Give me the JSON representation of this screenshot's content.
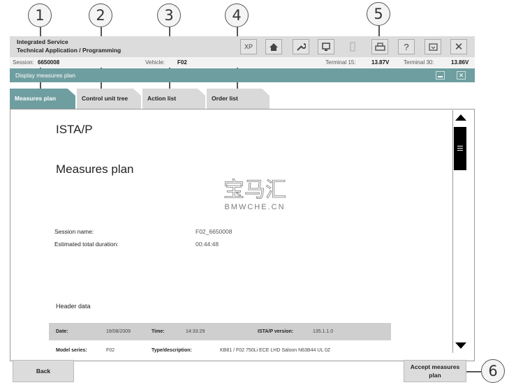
{
  "callouts": [
    "1",
    "2",
    "3",
    "4",
    "5",
    "6"
  ],
  "header": {
    "title_line1": "Integrated Service",
    "title_line2": "Technical Application / Programming",
    "xp_label": "XP",
    "help_glyph": "?",
    "close_glyph": "✕"
  },
  "session_bar": {
    "session_label": "Session:",
    "session_value": "6650008",
    "vehicle_label": "Vehicle:",
    "vehicle_value": "F02",
    "terminal15_label": "Terminal 15:",
    "terminal15_value": "13.87V",
    "terminal30_label": "Terminal 30:",
    "terminal30_value": "13.86V"
  },
  "window": {
    "title": "Display measures plan",
    "close_glyph": "✕"
  },
  "tabs": [
    {
      "label": "Measures plan",
      "active": true
    },
    {
      "label": "Control unit tree",
      "active": false
    },
    {
      "label": "Action list",
      "active": false
    },
    {
      "label": "Order list",
      "active": false
    }
  ],
  "document": {
    "app_name": "ISTA/P",
    "heading": "Measures plan",
    "session_name_label": "Session name:",
    "session_name_value": "F02_6650008",
    "duration_label": "Estimated total duration:",
    "duration_value": "00:44:48",
    "header_data_title": "Header data",
    "date_label": "Date:",
    "date_value": "19/08/2009",
    "time_label": "Time:",
    "time_value": "14:33:29",
    "version_label": "ISTA/P version:",
    "version_value": "135.1.1.0",
    "model_label": "Model series:",
    "model_value": "F02",
    "type_label": "Type/description:",
    "type_value": "KB81 / F02 750Li ECE LHD Saloon N63B44 UL 0Z"
  },
  "watermark": {
    "line1": "宝马汇",
    "line2": "BMWCHE.CN"
  },
  "buttons": {
    "back": "Back",
    "accept": "Accept measures plan"
  },
  "colors": {
    "accent": "#6f9ea0",
    "toolbar": "#dcdcdc"
  }
}
